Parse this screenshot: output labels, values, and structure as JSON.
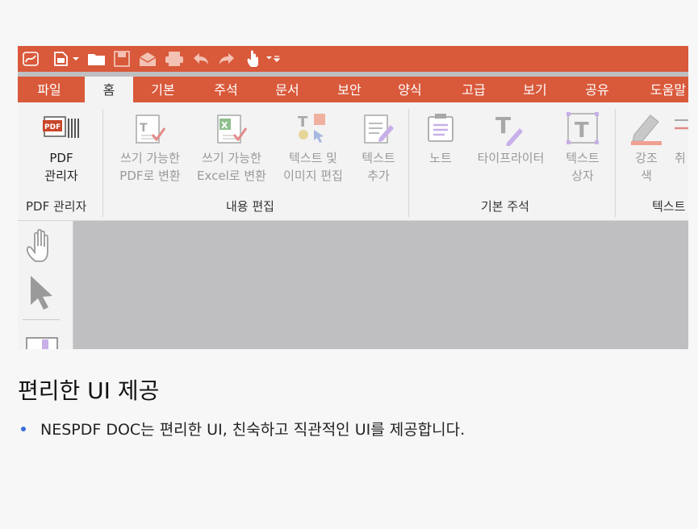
{
  "tabs": [
    "파일",
    "홈",
    "기본",
    "주석",
    "문서",
    "보안",
    "양식",
    "고급",
    "보기",
    "공유",
    "도움말"
  ],
  "active_tab": "홈",
  "ribbon": {
    "pdf_manager": {
      "line1": "PDF",
      "line2": "관리자"
    },
    "writable_pdf": {
      "line1": "쓰기 가능한",
      "line2": "PDF로 변환"
    },
    "writable_excel": {
      "line1": "쓰기 가능한",
      "line2": "Excel로 변환"
    },
    "edit_text_image": {
      "line1": "텍스트 및",
      "line2": "이미지 편집"
    },
    "add_text": {
      "line1": "텍스트",
      "line2": "추가"
    },
    "note": {
      "line1": "노트"
    },
    "typewriter": {
      "line1": "타이프라이터"
    },
    "text_box": {
      "line1": "텍스트",
      "line2": "상자"
    },
    "highlight": {
      "line1": "강조",
      "line2": "색"
    },
    "strike": {
      "line1": "취"
    },
    "groups": {
      "pdf_manager": "PDF 관리자",
      "content_edit": "내용 편집",
      "basic_annotation": "기본 주석",
      "text": "텍스트"
    }
  },
  "colors": {
    "title_bar": "#d9593b",
    "ribbon_bg": "#f3f3f3",
    "workspace": "#bfbfc1",
    "bullet": "#3a6fd8"
  },
  "heading": "편리한 UI 제공",
  "bullet": "NESPDF DOC는 편리한 UI, 친숙하고 직관적인 UI를 제공합니다."
}
